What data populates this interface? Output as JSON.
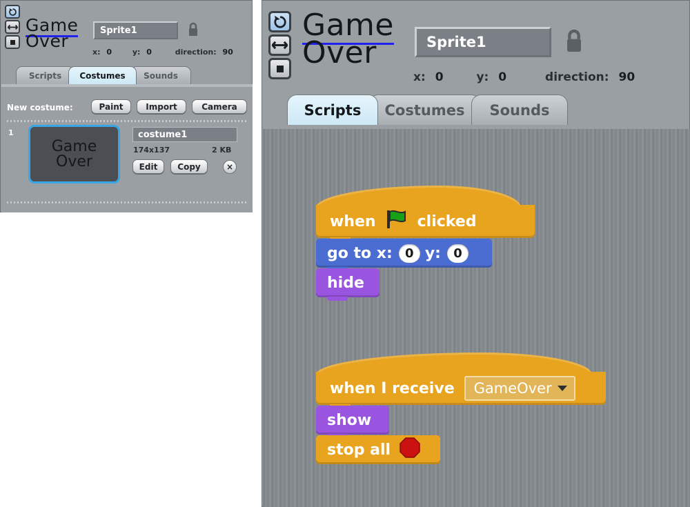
{
  "app": {
    "name": "Scratch",
    "accent_blue": "#37a6e6",
    "panel_gray": "#9a9fa3",
    "control_orange": "#e8a41e",
    "motion_blue": "#4b6cd1",
    "looks_purple": "#9a55e0",
    "stop_red": "#cc1111"
  },
  "left_panel": {
    "rotation_buttons": [
      {
        "name": "rotate-icon",
        "selected": true
      },
      {
        "name": "flip-horizontal-icon",
        "selected": false
      },
      {
        "name": "do-not-rotate-icon",
        "selected": false
      }
    ],
    "sprite_thumbnail": {
      "line1": "Game",
      "line2": "Over"
    },
    "sprite_name": "Sprite1",
    "lock_icon": "lock-icon",
    "x_label": "x:",
    "x_value": "0",
    "y_label": "y:",
    "y_value": "0",
    "direction_label": "direction:",
    "direction_value": "90",
    "tabs": [
      {
        "label": "Scripts",
        "active": false
      },
      {
        "label": "Costumes",
        "active": true
      },
      {
        "label": "Sounds",
        "active": false
      }
    ],
    "new_costume_label": "New costume:",
    "new_costume_buttons": [
      "Paint",
      "Import",
      "Camera"
    ],
    "costumes": [
      {
        "index": "1",
        "thumb_line1": "Game",
        "thumb_line2": "Over",
        "name": "costume1",
        "dimensions": "174x137",
        "size": "2 KB",
        "edit_label": "Edit",
        "copy_label": "Copy",
        "delete_label": "×"
      }
    ]
  },
  "right_panel": {
    "rotation_buttons": [
      {
        "name": "rotate-icon",
        "selected": true
      },
      {
        "name": "flip-horizontal-icon",
        "selected": false
      },
      {
        "name": "do-not-rotate-icon",
        "selected": false
      }
    ],
    "sprite_thumbnail": {
      "line1": "Game",
      "line2": "Over"
    },
    "sprite_name": "Sprite1",
    "lock_icon": "lock-icon",
    "x_label": "x:",
    "x_value": "0",
    "y_label": "y:",
    "y_value": "0",
    "direction_label": "direction:",
    "direction_value": "90",
    "tabs": [
      {
        "label": "Scripts",
        "active": true
      },
      {
        "label": "Costumes",
        "active": false
      },
      {
        "label": "Sounds",
        "active": false
      }
    ],
    "scripts": [
      {
        "id": "script-green-flag",
        "blocks": [
          {
            "type": "hat",
            "category": "control",
            "text_before": "when",
            "icon": "green-flag-icon",
            "text_after": "clicked"
          },
          {
            "type": "command",
            "category": "motion",
            "parts": [
              "go to x:",
              "0",
              "y:",
              "0"
            ],
            "label": "go to x: 0 y: 0"
          },
          {
            "type": "command",
            "category": "looks",
            "label": "hide"
          }
        ]
      },
      {
        "id": "script-when-i-receive",
        "blocks": [
          {
            "type": "hat",
            "category": "control",
            "label": "when I receive",
            "dropdown_value": "GameOver"
          },
          {
            "type": "command",
            "category": "looks",
            "label": "show"
          },
          {
            "type": "command",
            "category": "control",
            "label": "stop all",
            "icon": "stop-sign-icon"
          }
        ]
      }
    ]
  }
}
